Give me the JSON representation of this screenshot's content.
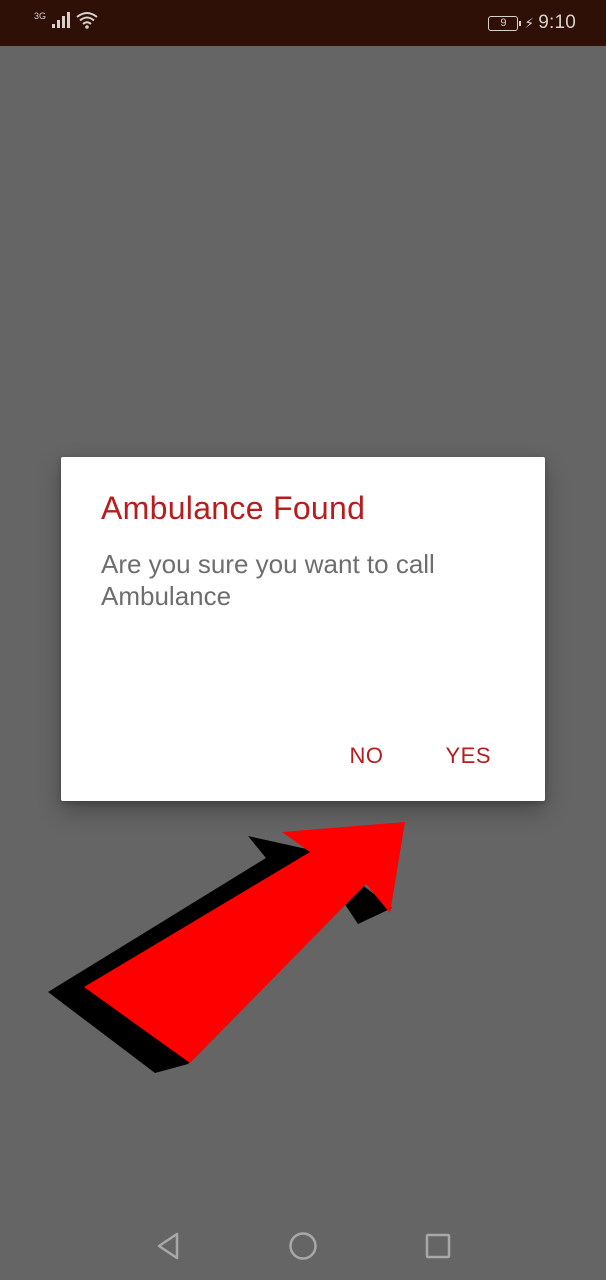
{
  "status_bar": {
    "network_type": "3G",
    "battery_level": "9",
    "time": "9:10"
  },
  "dialog": {
    "title": "Ambulance Found",
    "message": "Are you sure you want to call Ambulance",
    "no_label": "NO",
    "yes_label": "YES"
  },
  "colors": {
    "accent": "#b81c1c",
    "scrim": "#656565",
    "status_bar": "#2e1007",
    "annotation_arrow": "#ff0000"
  },
  "nav_bar": {
    "icons": [
      "back-icon",
      "home-icon",
      "recents-icon"
    ]
  }
}
